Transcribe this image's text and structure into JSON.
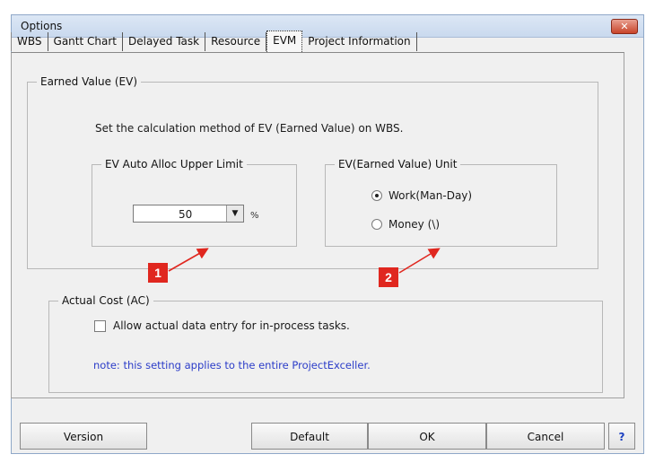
{
  "window": {
    "title": "Options",
    "close_label": "✕"
  },
  "tabs": [
    "WBS",
    "Gantt Chart",
    "Delayed Task",
    "Resource",
    "EVM",
    "Project Information"
  ],
  "active_tab": "EVM",
  "ev_section": {
    "legend": "Earned Value (EV)",
    "description": "Set the calculation method of EV (Earned Value) on WBS.",
    "limit_group": {
      "legend": "EV Auto Alloc Upper Limit",
      "value": "50",
      "unit": "%"
    },
    "unit_group": {
      "legend": "EV(Earned Value) Unit",
      "options": [
        "Work(Man-Day)",
        "Money (\\)"
      ],
      "selected": "Work(Man-Day)"
    }
  },
  "ac_section": {
    "legend": "Actual Cost (AC)",
    "checkbox_label": "Allow actual data entry for in-process tasks.",
    "checkbox_checked": false,
    "note": "note: this setting applies to the entire ProjectExceller."
  },
  "buttons": {
    "version": "Version",
    "default": "Default",
    "ok": "OK",
    "cancel": "Cancel",
    "help": "?"
  },
  "callouts": [
    "1",
    "2"
  ],
  "colors": {
    "callout": "#e0271f",
    "note_text": "#2b3cc8",
    "help_text": "#1a3fc0"
  }
}
